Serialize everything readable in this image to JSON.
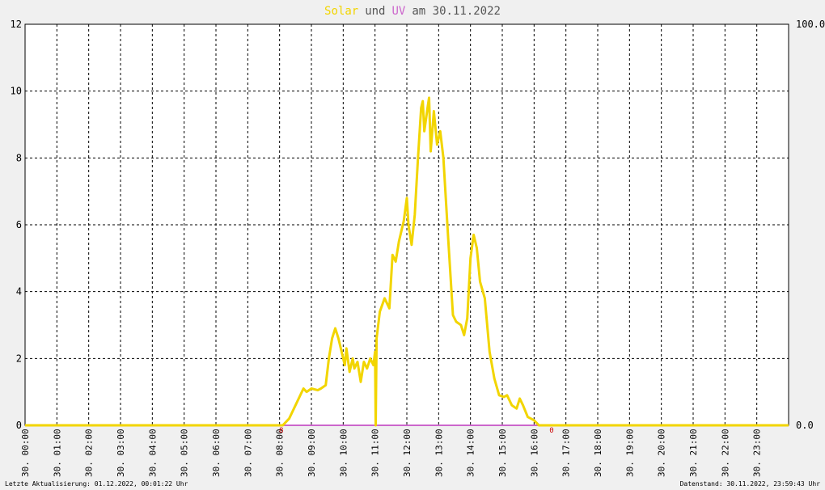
{
  "title": {
    "solar": "Solar",
    "und": "und",
    "uv": "UV",
    "rest": "am 30.11.2022"
  },
  "footer": {
    "left": "Letzte Aktualisierung: 01.12.2022, 00:01:22 Uhr",
    "right": "Datenstand: 30.11.2022, 23:59:43 Uhr"
  },
  "colors": {
    "solar": "#f2d500",
    "uv": "#cc66cc",
    "baseline": "#f08080",
    "grid": "#000000",
    "background": "#f0f0f0"
  },
  "chart_data": {
    "type": "line",
    "xlim": [
      0,
      24
    ],
    "ylim": [
      0,
      12
    ],
    "y2lim": [
      0,
      100
    ],
    "yticks": [
      0,
      2,
      4,
      6,
      8,
      10,
      12
    ],
    "y2ticks": [
      "0.0",
      "100.0"
    ],
    "xticks": [
      "30. 00:00",
      "30. 01:00",
      "30. 02:00",
      "30. 03:00",
      "30. 04:00",
      "30. 05:00",
      "30. 06:00",
      "30. 07:00",
      "30. 08:00",
      "30. 09:00",
      "30. 10:00",
      "30. 11:00",
      "30. 12:00",
      "30. 13:00",
      "30. 14:00",
      "30. 15:00",
      "30. 16:00",
      "30. 17:00",
      "30. 18:00",
      "30. 19:00",
      "30. 20:00",
      "30. 21:00",
      "30. 22:00",
      "30. 23:00"
    ],
    "markers": [
      {
        "x": 8.0,
        "label": "8"
      },
      {
        "x": 16.5,
        "label": "0"
      }
    ],
    "grid": true,
    "series": [
      {
        "name": "Solar",
        "x": [
          0,
          8.1,
          8.3,
          8.45,
          8.6,
          8.75,
          8.85,
          9.0,
          9.2,
          9.3,
          9.45,
          9.55,
          9.65,
          9.75,
          9.85,
          9.95,
          10.05,
          10.1,
          10.2,
          10.3,
          10.35,
          10.45,
          10.55,
          10.65,
          10.75,
          10.85,
          10.95,
          11.0,
          11.02,
          11.05,
          11.15,
          11.3,
          11.45,
          11.55,
          11.65,
          11.75,
          11.85,
          11.9,
          12.0,
          12.05,
          12.15,
          12.25,
          12.35,
          12.45,
          12.5,
          12.55,
          12.65,
          12.7,
          12.75,
          12.85,
          12.95,
          13.05,
          13.15,
          13.3,
          13.45,
          13.55,
          13.7,
          13.8,
          13.9,
          14.0,
          14.1,
          14.2,
          14.3,
          14.45,
          14.6,
          14.75,
          14.9,
          15.05,
          15.15,
          15.3,
          15.45,
          15.55,
          15.65,
          15.8,
          15.9,
          16.0,
          16.1,
          16.15,
          24
        ],
        "values": [
          0,
          0,
          0.2,
          0.5,
          0.8,
          1.1,
          1.0,
          1.1,
          1.05,
          1.1,
          1.2,
          2.0,
          2.6,
          2.9,
          2.6,
          2.2,
          1.8,
          2.3,
          1.6,
          2.0,
          1.7,
          1.9,
          1.3,
          1.9,
          1.7,
          2.0,
          1.8,
          2.2,
          0,
          2.6,
          3.4,
          3.8,
          3.5,
          5.1,
          4.9,
          5.5,
          5.9,
          6.1,
          6.8,
          6.0,
          5.4,
          6.3,
          8.0,
          9.5,
          9.7,
          8.8,
          9.5,
          9.8,
          8.2,
          9.4,
          8.4,
          8.8,
          8.0,
          5.6,
          3.3,
          3.1,
          3.0,
          2.7,
          3.2,
          5.0,
          5.7,
          5.3,
          4.3,
          3.8,
          2.2,
          1.4,
          0.9,
          0.85,
          0.9,
          0.6,
          0.5,
          0.8,
          0.6,
          0.25,
          0.2,
          0.15,
          0.05,
          0,
          0
        ]
      },
      {
        "name": "UV",
        "x": [
          0,
          24
        ],
        "values": [
          0,
          0
        ]
      }
    ]
  }
}
